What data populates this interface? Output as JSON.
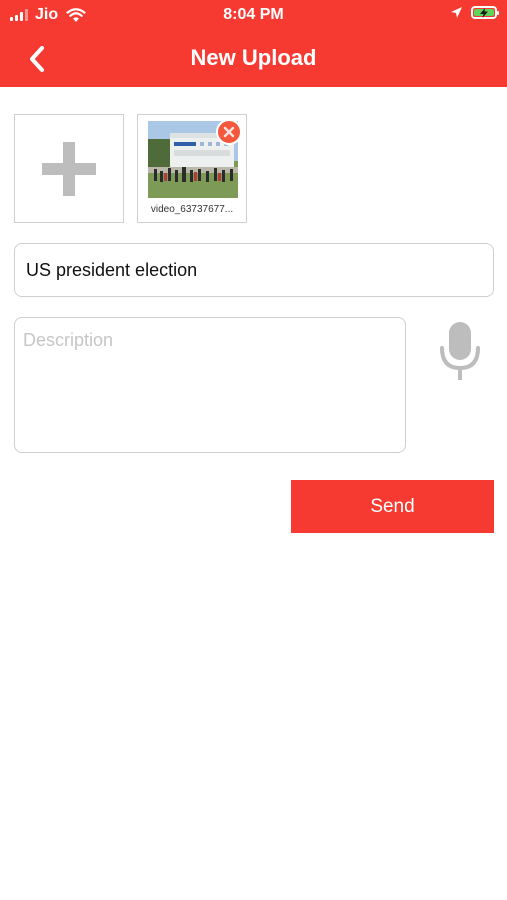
{
  "status_bar": {
    "carrier": "Jio",
    "time": "8:04 PM",
    "icons": [
      "signal-icon",
      "wifi-icon",
      "location-arrow-icon",
      "battery-charging-icon"
    ]
  },
  "header": {
    "title": "New Upload",
    "back_icon": "chevron-left-icon",
    "background_color": "#f63a32"
  },
  "media": {
    "add_icon": "plus-icon",
    "items": [
      {
        "filename": "video_63737677...",
        "remove_icon": "remove-badge-icon"
      }
    ]
  },
  "form": {
    "title_value": "US president election",
    "description_placeholder": "Description",
    "mic_icon": "microphone-icon",
    "send_label": "Send"
  },
  "colors": {
    "accent": "#f63a32",
    "border": "#cfcfcf",
    "placeholder": "#c6c6c6",
    "icon_gray": "#bdbdbd"
  }
}
